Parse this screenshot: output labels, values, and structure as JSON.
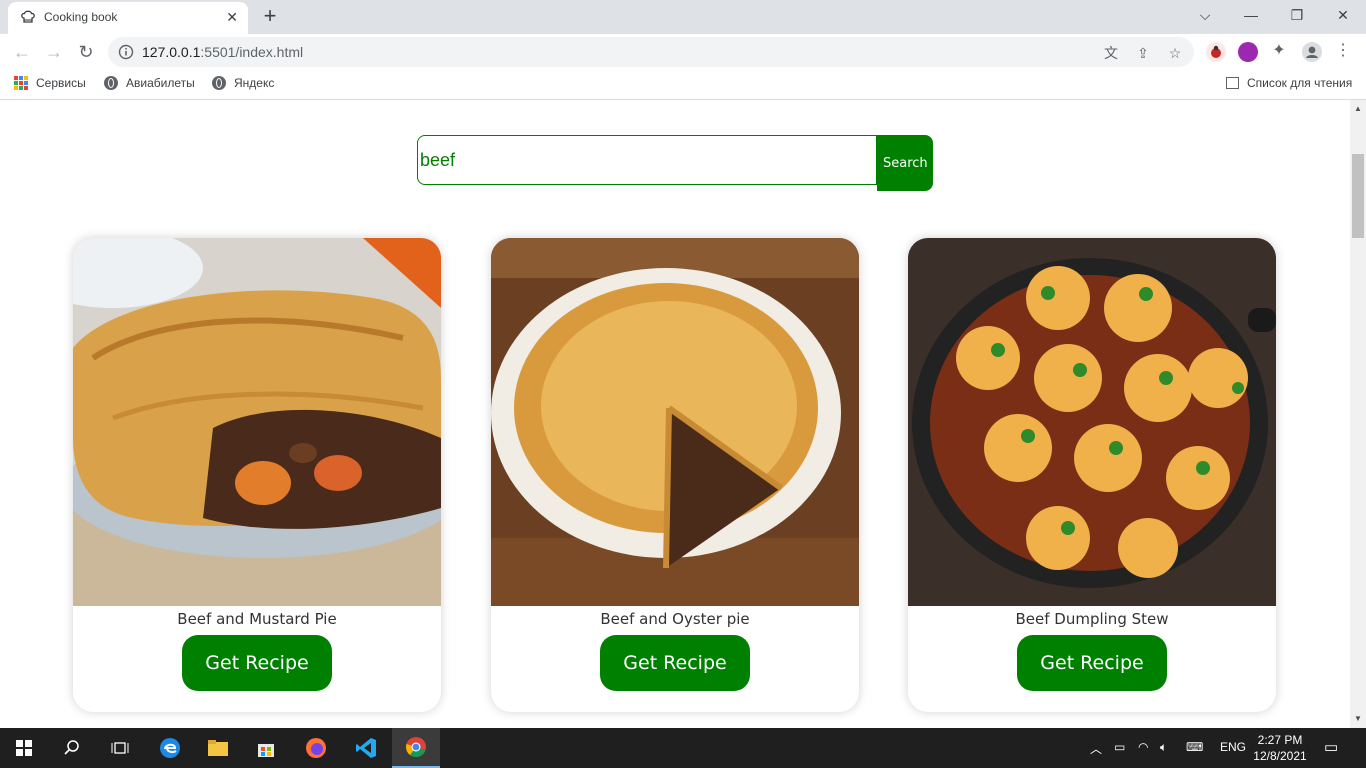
{
  "browser": {
    "tab_title": "Cooking book",
    "url_host": "127.0.0.1",
    "url_rest": ":5501/index.html",
    "bookmarks": [
      "Сервисы",
      "Авиабилеты",
      "Яндекс"
    ],
    "reading_list": "Список для чтения"
  },
  "search": {
    "value": "beef",
    "button_label": "Search"
  },
  "recipes": [
    {
      "name": "Beef and Mustard Pie",
      "button": "Get Recipe"
    },
    {
      "name": "Beef and Oyster pie",
      "button": "Get Recipe"
    },
    {
      "name": "Beef Dumpling Stew",
      "button": "Get Recipe"
    }
  ],
  "taskbar": {
    "language": "ENG",
    "time": "2:27 PM",
    "date": "12/8/2021"
  },
  "colors": {
    "accent": "#008000",
    "tab_strip": "#dee1e6",
    "taskbar": "#1f1f1f"
  }
}
